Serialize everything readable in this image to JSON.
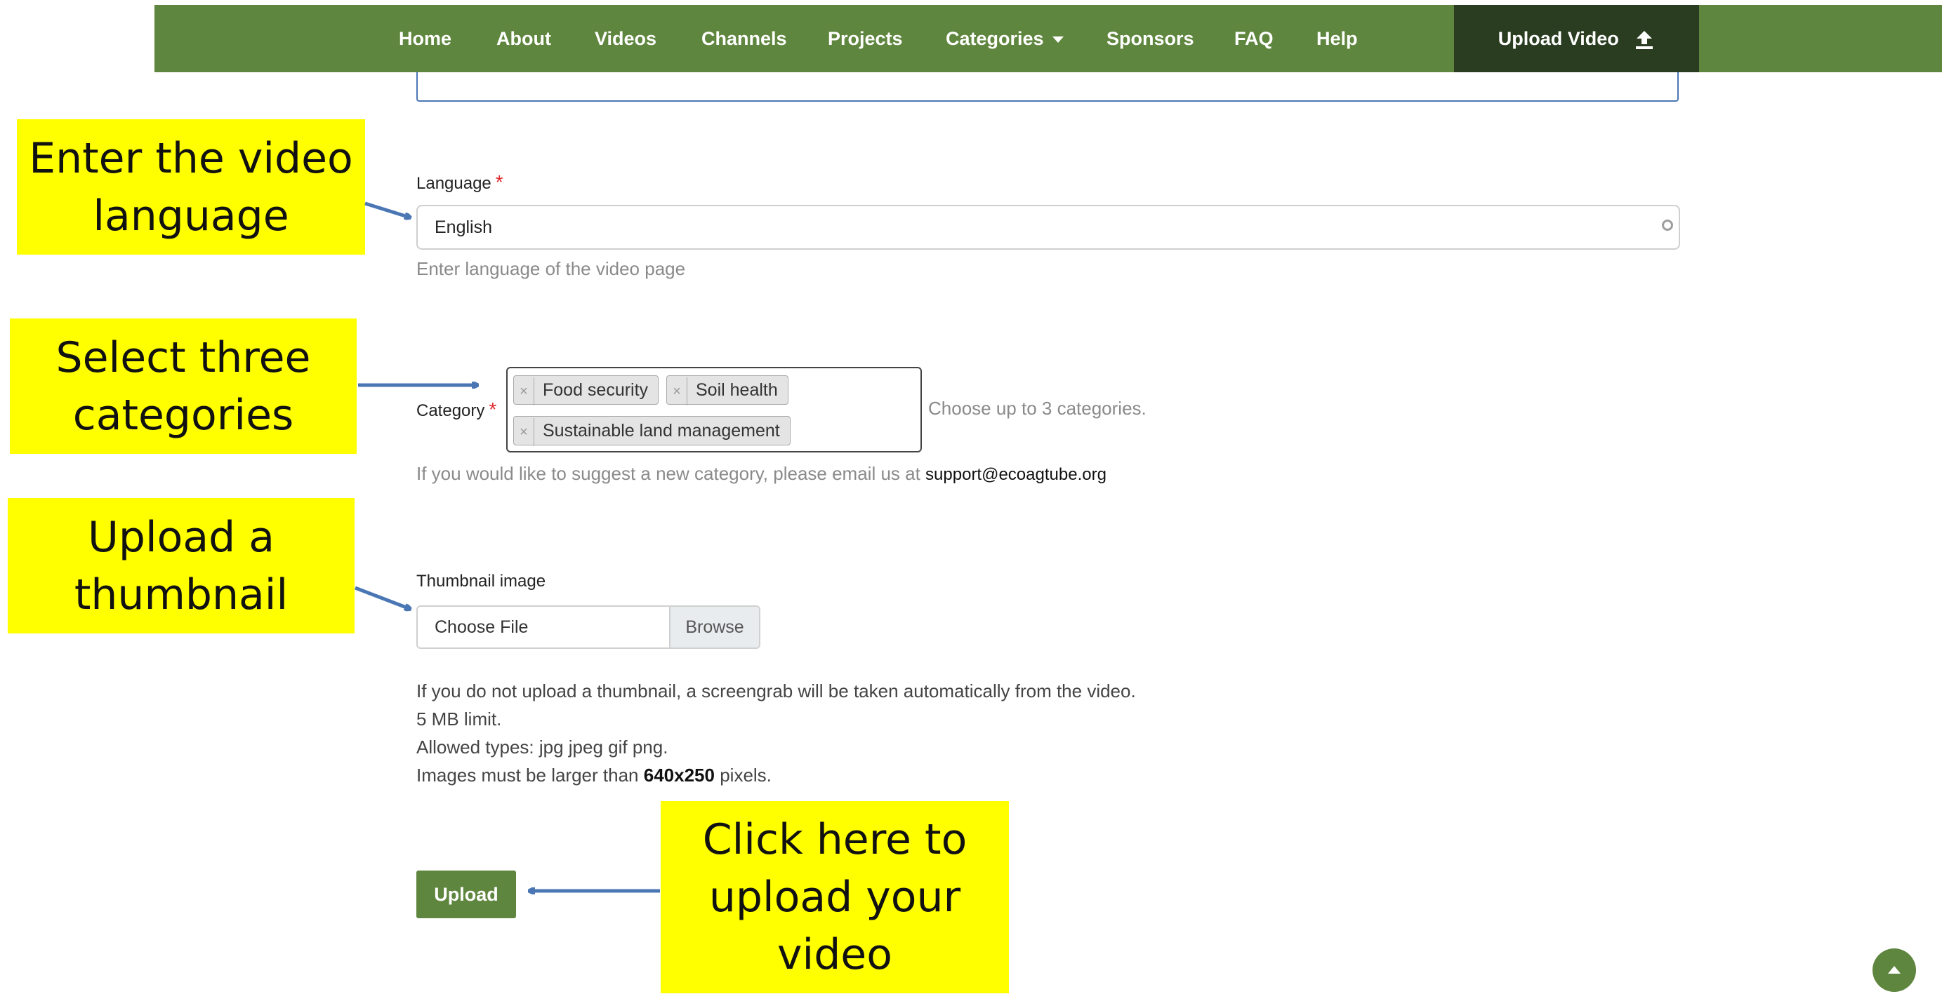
{
  "nav": {
    "items": [
      {
        "label": "Home"
      },
      {
        "label": "About"
      },
      {
        "label": "Videos"
      },
      {
        "label": "Channels"
      },
      {
        "label": "Projects"
      },
      {
        "label": "Categories"
      },
      {
        "label": "Sponsors"
      },
      {
        "label": "FAQ"
      },
      {
        "label": "Help"
      }
    ],
    "upload_label": "Upload Video",
    "upload_icon": "upload-icon"
  },
  "language": {
    "label": "Language",
    "required_mark": "*",
    "value": "English",
    "help": "Enter language of the video page"
  },
  "category": {
    "label": "Category",
    "required_mark": "*",
    "tags": [
      "Food security",
      "Soil health",
      "Sustainable land management"
    ],
    "remove_glyph": "×",
    "limit_text": "Choose up to 3 categories.",
    "suggest_text": "If you would like to suggest a new category, please email us at",
    "email": "support@ecoagtube.org"
  },
  "thumbnail": {
    "label": "Thumbnail image",
    "choose_text": "Choose File",
    "browse_label": "Browse",
    "info_1": "If you do not upload a thumbnail, a screengrab will be taken automatically from the video.",
    "info_2": "5 MB limit.",
    "info_3": "Allowed types: jpg jpeg gif png.",
    "info_4_prefix": "Images must be larger than",
    "info_4_size": "640x250",
    "info_4_suffix": "pixels."
  },
  "upload_button": "Upload",
  "callouts": {
    "language": [
      "Enter the video",
      "language"
    ],
    "category": [
      "Select three",
      "categories"
    ],
    "thumbnail": [
      "Upload a",
      "thumbnail"
    ],
    "upload": [
      "Click here to",
      "upload your",
      "video"
    ]
  },
  "colors": {
    "brand_green": "#5f863e",
    "dark_green": "#2a3d20",
    "callout_yellow": "#ffff00",
    "arrow_blue": "#4a77b4",
    "required_red": "#e0282b"
  }
}
